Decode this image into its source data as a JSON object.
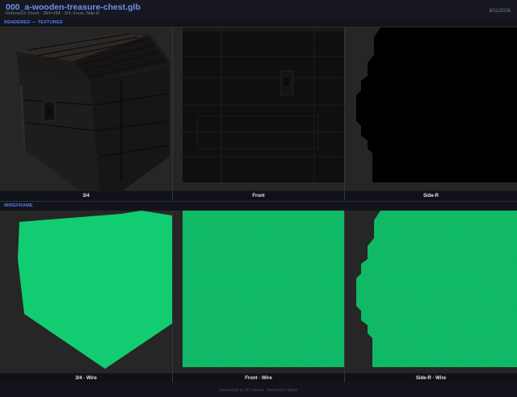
{
  "header": {
    "title": "000_a-wooden-treasure-chest.glb",
    "subtitle": "Reference Sheet  ·  384×384  ·  3/4, Front, Side-R",
    "date": "8/11/2026"
  },
  "sections": {
    "rendered_label": "RENDERED — TEXTURED",
    "wireframe_label": "WIREFRAME"
  },
  "rendered_views": [
    {
      "caption": "3/4"
    },
    {
      "caption": "Front"
    },
    {
      "caption": "Side-R"
    }
  ],
  "wireframe_views": [
    {
      "caption": "3/4 · Wire"
    },
    {
      "caption": "Front · Wire"
    },
    {
      "caption": "Side-R · Wire"
    }
  ],
  "footer": {
    "text": "Generated by 3D Viewer · Reference Sheet"
  },
  "colors": {
    "accent": "#6f8ff0",
    "section_accent": "#4f7ff0",
    "wire_fill": "#12d475",
    "wire_dark": "#0c9e55",
    "panel_bg": "#262626",
    "page_bg": "#13141b"
  }
}
